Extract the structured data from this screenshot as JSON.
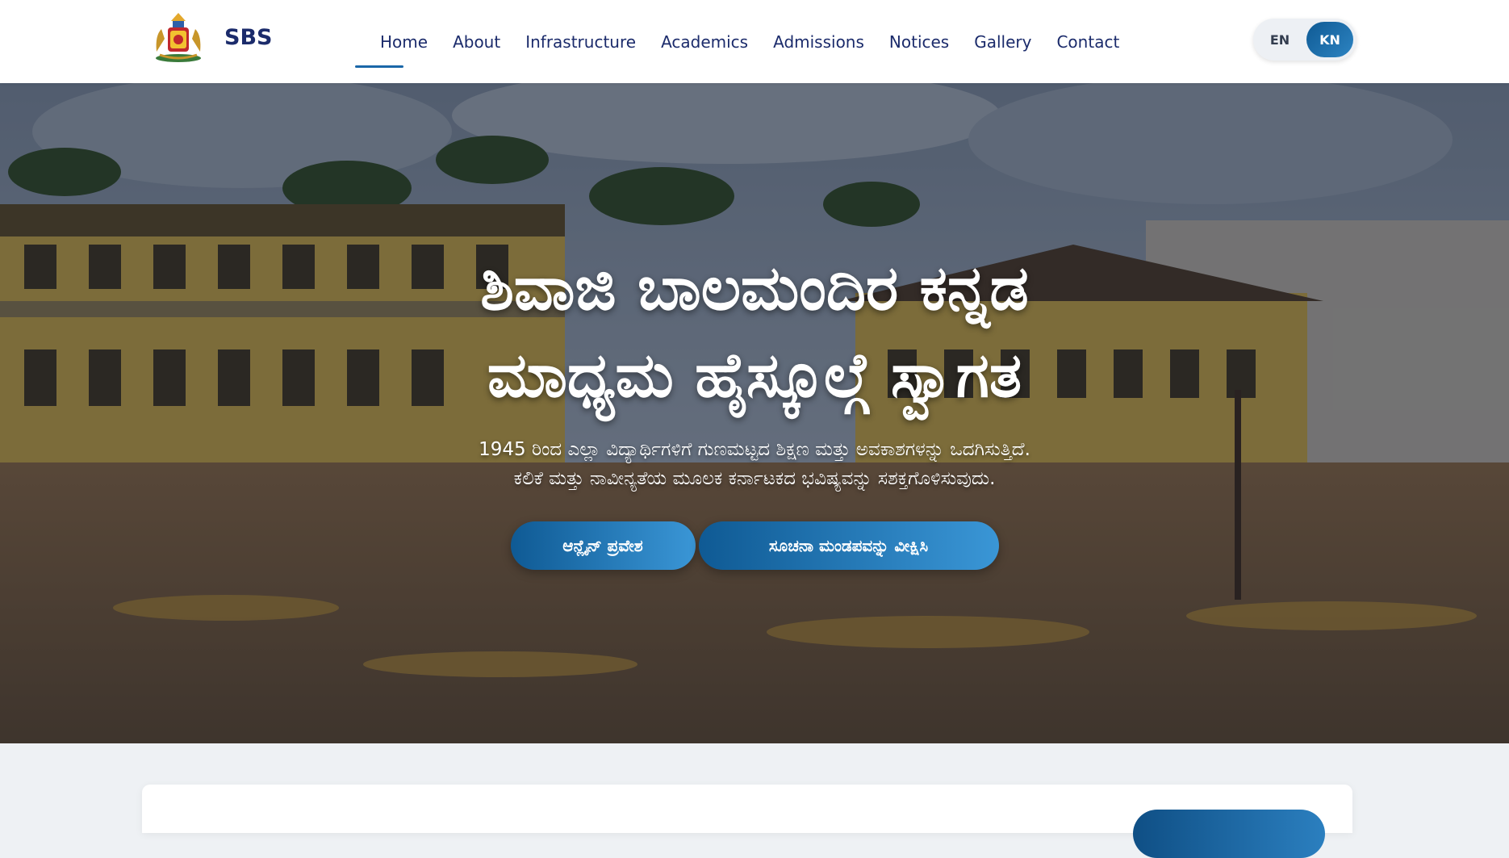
{
  "brand": {
    "name": "SBS",
    "logo_icon": "karnataka-emblem-icon"
  },
  "nav": {
    "items": [
      {
        "label": "Home",
        "active": true
      },
      {
        "label": "About"
      },
      {
        "label": "Infrastructure"
      },
      {
        "label": "Academics"
      },
      {
        "label": "Admissions"
      },
      {
        "label": "Notices"
      },
      {
        "label": "Gallery"
      },
      {
        "label": "Contact"
      }
    ],
    "language": {
      "en": "EN",
      "kn": "KN",
      "selected": "KN"
    }
  },
  "hero": {
    "title_line1": "ಶಿವಾಜಿ ಬಾಲಮಂದಿರ ಕನ್ನಡ",
    "title_line2": "ಮಾಧ್ಯಮ ಹೈಸ್ಕೂಲ್ಗೆ ಸ್ವಾಗತ",
    "subtitle_line1": "1945 ರಿಂದ ಎಲ್ಲಾ ವಿದ್ಯಾರ್ಥಿಗಳಿಗೆ ಗುಣಮಟ್ಟದ ಶಿಕ್ಷಣ ಮತ್ತು ಅವಕಾಶಗಳನ್ನು ಒದಗಿಸುತ್ತಿದೆ.",
    "subtitle_line2": "ಕಲಿಕೆ ಮತ್ತು ನಾವೀನ್ಯತೆಯ ಮೂಲಕ ಕರ್ನಾಟಕದ ಭವಿಷ್ಯವನ್ನು ಸಶಕ್ತಗೊಳಿಸುವುದು.",
    "primary_button": "ಆನ್ಲೈನ್ ಪ್ರವೇಶ",
    "secondary_button": "ಸೂಚನಾ ಮಂಡಪವನ್ನು ವೀಕ್ಷಿಸಿ"
  },
  "colors": {
    "brand_navy": "#1b2b6b",
    "accent_blue": "#1a67a8",
    "button_gradient_start": "#0f5a94",
    "button_gradient_end": "#3a96d6"
  }
}
